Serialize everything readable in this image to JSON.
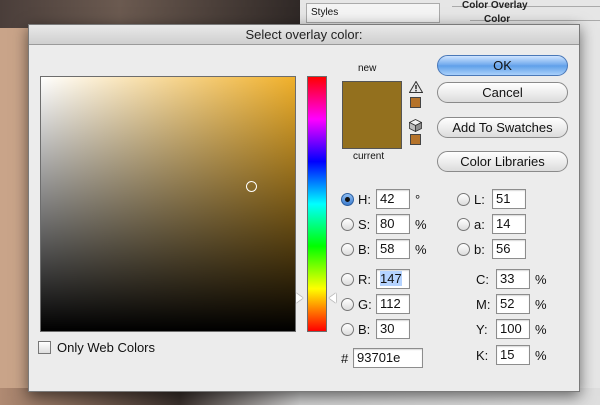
{
  "dialog": {
    "title": "Select overlay color:",
    "new_label": "new",
    "current_label": "current",
    "color": "#93701e",
    "swatch_chip_color": "#b5732a"
  },
  "buttons": {
    "ok": "OK",
    "cancel": "Cancel",
    "add_swatches": "Add To Swatches",
    "color_libraries": "Color Libraries"
  },
  "hsb": {
    "h": {
      "label": "H:",
      "value": "42",
      "unit": "°"
    },
    "s": {
      "label": "S:",
      "value": "80",
      "unit": "%"
    },
    "b": {
      "label": "B:",
      "value": "58",
      "unit": "%"
    }
  },
  "rgb": {
    "r": {
      "label": "R:",
      "value": "147"
    },
    "g": {
      "label": "G:",
      "value": "112"
    },
    "b": {
      "label": "B:",
      "value": "30"
    }
  },
  "lab": {
    "l": {
      "label": "L:",
      "value": "51"
    },
    "a": {
      "label": "a:",
      "value": "14"
    },
    "b": {
      "label": "b:",
      "value": "56"
    }
  },
  "cmyk": {
    "c": {
      "label": "C:",
      "value": "33",
      "unit": "%"
    },
    "m": {
      "label": "M:",
      "value": "52",
      "unit": "%"
    },
    "y": {
      "label": "Y:",
      "value": "100",
      "unit": "%"
    },
    "k": {
      "label": "K:",
      "value": "15",
      "unit": "%"
    }
  },
  "hex": {
    "label": "#",
    "value": "93701e"
  },
  "web_colors": {
    "label": "Only Web Colors",
    "checked": false
  },
  "background": {
    "styles_label": "Styles",
    "color_overlay_title": "Color Overlay",
    "color_sub": "Color"
  }
}
